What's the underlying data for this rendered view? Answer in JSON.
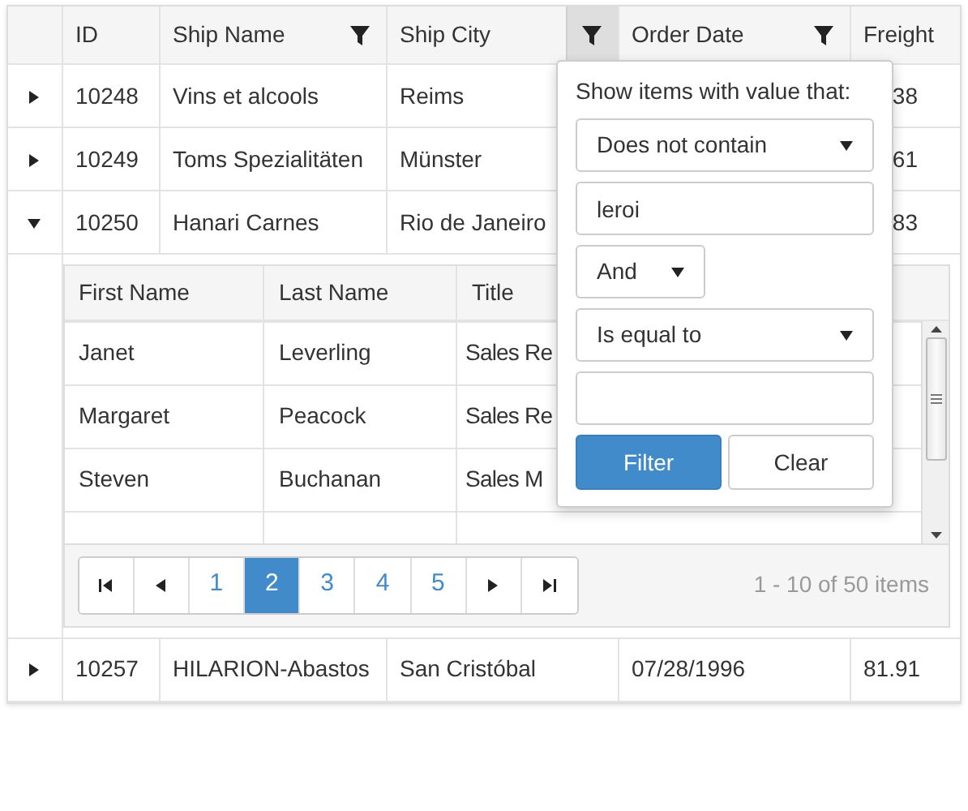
{
  "grid": {
    "columns": [
      {
        "label": "ID",
        "filterable": false
      },
      {
        "label": "Ship Name",
        "filterable": true,
        "menu_open": false
      },
      {
        "label": "Ship City",
        "filterable": true,
        "menu_open": true
      },
      {
        "label": "Order Date",
        "filterable": true,
        "menu_open": false
      },
      {
        "label": "Freight",
        "filterable": false
      }
    ],
    "rows": [
      {
        "expanded": false,
        "cells": [
          "10248",
          "Vins et alcools",
          "Reims",
          null,
          "38"
        ]
      },
      {
        "expanded": false,
        "cells": [
          "10249",
          "Toms Spezialitäten",
          "Münster",
          null,
          "61"
        ]
      },
      {
        "expanded": true,
        "cells": [
          "10250",
          "Hanari Carnes",
          "Rio de Janeiro",
          null,
          "83"
        ],
        "detail": {
          "columns": [
            "First Name",
            "Last Name",
            "Title"
          ],
          "rows": [
            [
              "Janet",
              "Leverling",
              "Sales Re"
            ],
            [
              "Margaret",
              "Peacock",
              "Sales Re"
            ],
            [
              "Steven",
              "Buchanan",
              "Sales M"
            ]
          ],
          "pager": {
            "pages": [
              {
                "label": "1",
                "selected": false
              },
              {
                "label": "2",
                "selected": true
              },
              {
                "label": "3",
                "selected": false
              },
              {
                "label": "4",
                "selected": false
              },
              {
                "label": "5",
                "selected": false
              }
            ],
            "info": "1 - 10 of 50 items"
          }
        }
      },
      {
        "expanded": false,
        "cells": [
          "10257",
          "HILARION-Abastos",
          "San Cristóbal",
          "07/28/1996",
          "81.91"
        ]
      }
    ]
  },
  "filter_menu": {
    "prompt": "Show items with value that:",
    "operator_1": "Does not contain",
    "value_1": "leroi",
    "logic": "And",
    "operator_2": "Is equal to",
    "buttons": [
      {
        "label": "Filter",
        "kind": "primary"
      },
      {
        "label": "Clear",
        "kind": "default"
      }
    ]
  }
}
